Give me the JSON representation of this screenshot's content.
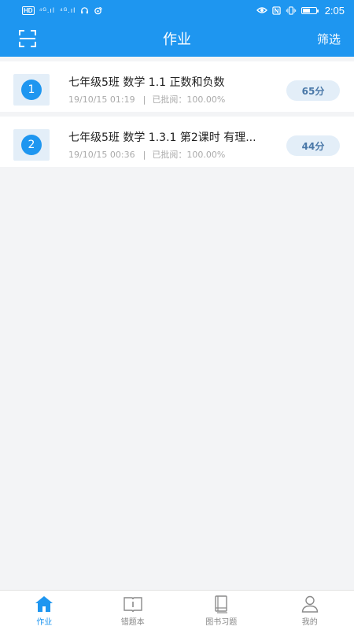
{
  "status_bar": {
    "hd_label": "HD",
    "signal_1": "⁴ᴳ.ıl",
    "signal_2": "⁴ᴳ.ıl",
    "time": "2:05",
    "battery_fraction": 0.6
  },
  "header": {
    "title": "作业",
    "filter_label": "筛选",
    "scan_icon": "scan-icon"
  },
  "homework": [
    {
      "index": "1",
      "title": "七年级5班 数学 1.1  正数和负数",
      "date": "19/10/15 01:19",
      "separator": "|",
      "review_label": "已批阅：",
      "review_value": "100.00%",
      "score": "65分"
    },
    {
      "index": "2",
      "title": "七年级5班 数学 1.3.1  第2课时  有理...",
      "date": "19/10/15 00:36",
      "separator": "|",
      "review_label": "已批阅：",
      "review_value": "100.00%",
      "score": "44分"
    }
  ],
  "bottom_nav": [
    {
      "label": "作业",
      "icon": "home-icon",
      "active": true
    },
    {
      "label": "错题本",
      "icon": "book-open-icon",
      "active": false
    },
    {
      "label": "图书习题",
      "icon": "book-stack-icon",
      "active": false
    },
    {
      "label": "我的",
      "icon": "user-icon",
      "active": false
    }
  ],
  "colors": {
    "primary": "#1e96f0",
    "background": "#f3f4f6",
    "pill_bg": "#e3eef8",
    "pill_text": "#4a78a8"
  }
}
